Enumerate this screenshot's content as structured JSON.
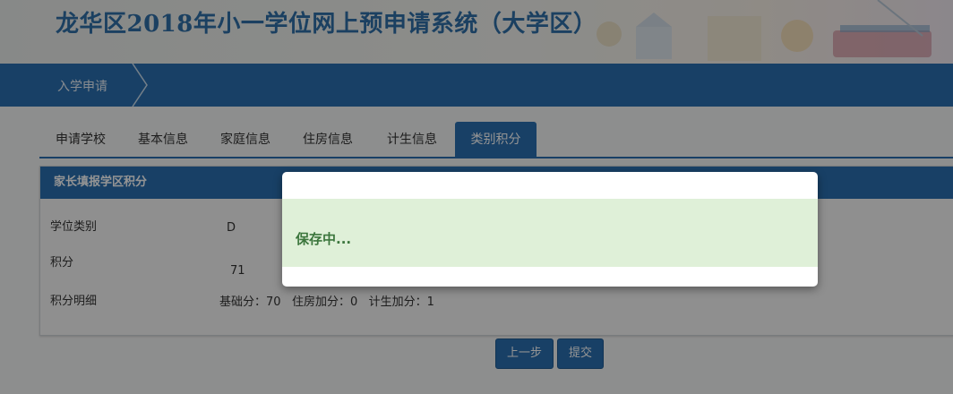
{
  "header": {
    "title": "龙华区2018年小一学位网上预申请系统（大学区）"
  },
  "nav": {
    "current": "入学申请"
  },
  "tabs": [
    {
      "label": "申请学校"
    },
    {
      "label": "基本信息"
    },
    {
      "label": "家庭信息"
    },
    {
      "label": "住房信息"
    },
    {
      "label": "计生信息"
    },
    {
      "label": "类别积分"
    }
  ],
  "active_tab": "类别积分",
  "panel": {
    "title": "家长填报学区积分",
    "rows": [
      {
        "label": "学位类别",
        "value": "D"
      },
      {
        "label": "积分",
        "value": "71"
      },
      {
        "label": "积分明细",
        "value": "基础分：70   住房加分：0   计生加分：1"
      }
    ]
  },
  "buttons": {
    "prev": "上一步",
    "submit": "提交"
  },
  "modal": {
    "message": "保存中..."
  },
  "colors": {
    "primary": "#2a6fb0",
    "success_bg": "#dff0d8",
    "success_text": "#3c763d"
  }
}
